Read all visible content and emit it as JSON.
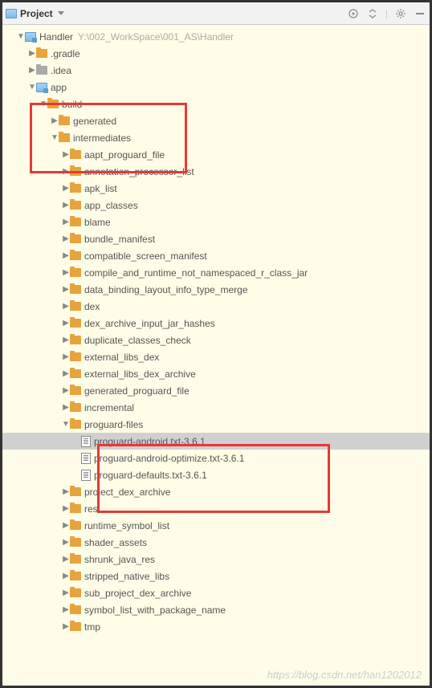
{
  "toolbar": {
    "title": "Project"
  },
  "root": {
    "name": "Handler",
    "path": "Y:\\002_WorkSpace\\001_AS\\Handler"
  },
  "rootChildren": [
    {
      "label": ".gradle",
      "icon": "folder",
      "expanded": false
    },
    {
      "label": ".idea",
      "icon": "folder-grey",
      "expanded": false
    }
  ],
  "app": {
    "label": "app"
  },
  "build": {
    "label": "build"
  },
  "generated": {
    "label": "generated"
  },
  "intermediates": {
    "label": "intermediates"
  },
  "intermediate_folders_before": [
    "aapt_proguard_file",
    "annotation_processor_list",
    "apk_list",
    "app_classes",
    "blame",
    "bundle_manifest",
    "compatible_screen_manifest",
    "compile_and_runtime_not_namespaced_r_class_jar",
    "data_binding_layout_info_type_merge",
    "dex",
    "dex_archive_input_jar_hashes",
    "duplicate_classes_check",
    "external_libs_dex",
    "external_libs_dex_archive",
    "generated_proguard_file",
    "incremental"
  ],
  "proguard": {
    "label": "proguard-files",
    "files": [
      "proguard-android.txt-3.6.1",
      "proguard-android-optimize.txt-3.6.1",
      "proguard-defaults.txt-3.6.1"
    ]
  },
  "intermediate_folders_after": [
    "project_dex_archive",
    "res",
    "runtime_symbol_list",
    "shader_assets",
    "shrunk_java_res",
    "stripped_native_libs",
    "sub_project_dex_archive",
    "symbol_list_with_package_name",
    "tmp"
  ],
  "watermark": "https://blog.csdn.net/han1202012"
}
